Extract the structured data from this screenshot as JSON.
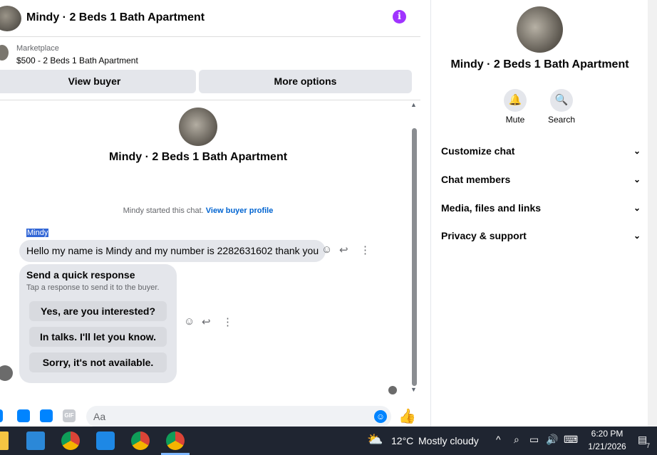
{
  "header": {
    "title": "Mindy · 2 Beds 1 Bath Apartment",
    "info_icon": "info-icon"
  },
  "listing": {
    "label": "Marketplace",
    "title": "$500 - 2 Beds 1 Bath Apartment",
    "view_buyer": "View buyer",
    "more_options": "More options"
  },
  "conversation": {
    "name": "Mindy · 2 Beds 1 Bath Apartment",
    "started_text": "Mindy started this chat.",
    "started_link": "View buyer profile",
    "sender": "Mindy",
    "message": "Hello my name is Mindy and my number is 2282631602 thank you",
    "quick_title": "Send a quick response",
    "quick_subtitle": "Tap a response to send it to the buyer.",
    "quick_options": [
      "Yes, are you interested?",
      "In talks. I'll let you know.",
      "Sorry, it's not available."
    ]
  },
  "composer": {
    "placeholder": "Aa",
    "gif": "GIF"
  },
  "details": {
    "name": "Mindy · 2 Beds 1 Bath Apartment",
    "mute": "Mute",
    "search": "Search",
    "rows": [
      "Customize chat",
      "Chat members",
      "Media, files and links",
      "Privacy & support"
    ]
  },
  "taskbar": {
    "temperature": "12°C",
    "weather": "Mostly cloudy",
    "time": "6:20 PM",
    "date": "1/21/2026",
    "notifications": "7"
  },
  "colors": {
    "accent": "#0084ff",
    "info": "#a033ff",
    "bubble": "#e4e6eb",
    "taskbar": "#1f2531"
  }
}
